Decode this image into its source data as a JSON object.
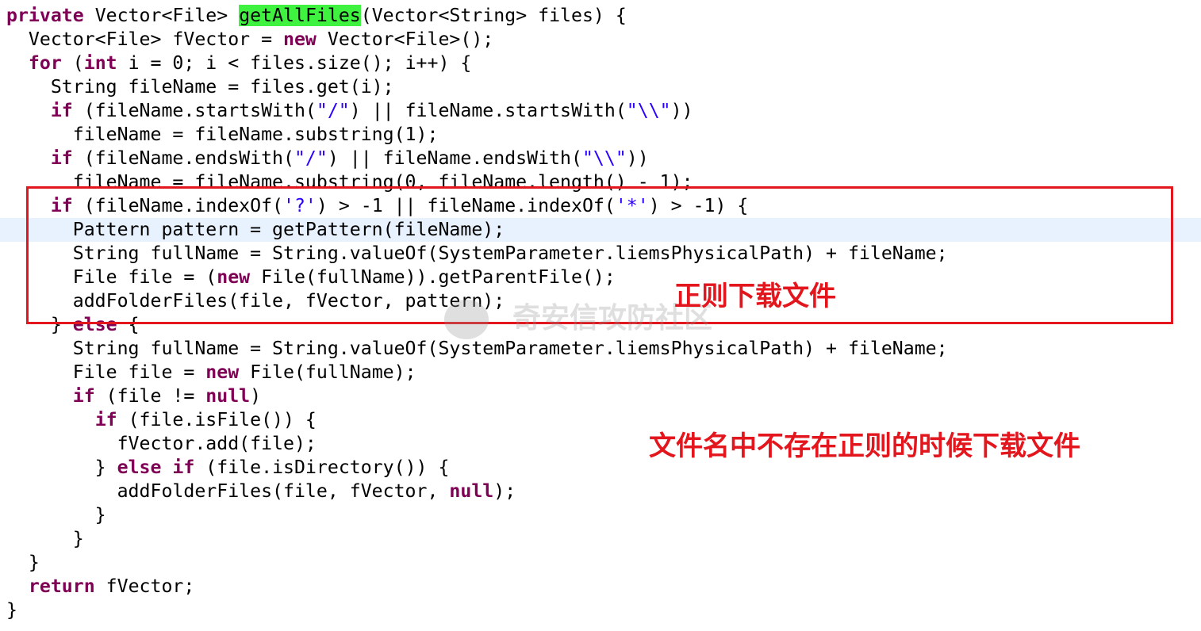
{
  "editor": {
    "highlight_color": "#3ff23f",
    "current_line_index": 9,
    "lines": [
      [
        [
          "k",
          "private"
        ],
        [
          "p",
          " Vector<File> "
        ],
        [
          "h",
          "getAllFiles"
        ],
        [
          "p",
          "(Vector<String> files) {"
        ]
      ],
      [
        [
          "p",
          "  Vector<File> fVector = "
        ],
        [
          "k",
          "new"
        ],
        [
          "p",
          " Vector<File>();"
        ]
      ],
      [
        [
          "p",
          "  "
        ],
        [
          "k",
          "for"
        ],
        [
          "p",
          " ("
        ],
        [
          "k",
          "int"
        ],
        [
          "p",
          " i = 0; i < files.size(); i++) {"
        ]
      ],
      [
        [
          "p",
          "    String fileName = files.get(i);"
        ]
      ],
      [
        [
          "p",
          "    "
        ],
        [
          "k",
          "if"
        ],
        [
          "p",
          " (fileName.startsWith("
        ],
        [
          "s",
          "\"/\""
        ],
        [
          "p",
          ") || fileName.startsWith("
        ],
        [
          "s",
          "\"\\\\\""
        ],
        [
          "p",
          "))"
        ]
      ],
      [
        [
          "p",
          "      fileName = fileName.substring(1);"
        ]
      ],
      [
        [
          "p",
          "    "
        ],
        [
          "k",
          "if"
        ],
        [
          "p",
          " (fileName.endsWith("
        ],
        [
          "s",
          "\"/\""
        ],
        [
          "p",
          ") || fileName.endsWith("
        ],
        [
          "s",
          "\"\\\\\""
        ],
        [
          "p",
          "))"
        ]
      ],
      [
        [
          "p",
          "      fileName = fileName.substring(0, fileName.length() - 1);"
        ]
      ],
      [
        [
          "p",
          "    "
        ],
        [
          "k",
          "if"
        ],
        [
          "p",
          " (fileName.indexOf("
        ],
        [
          "s",
          "'?'"
        ],
        [
          "p",
          ") > -1 || fileName.indexOf("
        ],
        [
          "s",
          "'*'"
        ],
        [
          "p",
          ") > -1) {"
        ]
      ],
      [
        [
          "p",
          "      Pattern pattern = getPattern(fileName);"
        ]
      ],
      [
        [
          "p",
          "      String fullName = String.valueOf(SystemParameter.liemsPhysicalPath) + fileName;"
        ]
      ],
      [
        [
          "p",
          "      File file = ("
        ],
        [
          "k",
          "new"
        ],
        [
          "p",
          " File(fullName)).getParentFile();"
        ]
      ],
      [
        [
          "p",
          "      addFolderFiles(file, fVector, pattern);"
        ]
      ],
      [
        [
          "p",
          "    } "
        ],
        [
          "k",
          "else"
        ],
        [
          "p",
          " {"
        ]
      ],
      [
        [
          "p",
          "      String fullName = String.valueOf(SystemParameter.liemsPhysicalPath) + fileName;"
        ]
      ],
      [
        [
          "p",
          "      File file = "
        ],
        [
          "k",
          "new"
        ],
        [
          "p",
          " File(fullName);"
        ]
      ],
      [
        [
          "p",
          "      "
        ],
        [
          "k",
          "if"
        ],
        [
          "p",
          " (file != "
        ],
        [
          "k",
          "null"
        ],
        [
          "p",
          ")"
        ]
      ],
      [
        [
          "p",
          "        "
        ],
        [
          "k",
          "if"
        ],
        [
          "p",
          " (file.isFile()) {"
        ]
      ],
      [
        [
          "p",
          "          fVector.add(file);"
        ]
      ],
      [
        [
          "p",
          "        } "
        ],
        [
          "k",
          "else if"
        ],
        [
          "p",
          " (file.isDirectory()) {"
        ]
      ],
      [
        [
          "p",
          "          addFolderFiles(file, fVector, "
        ],
        [
          "k",
          "null"
        ],
        [
          "p",
          ");"
        ]
      ],
      [
        [
          "p",
          "        }"
        ]
      ],
      [
        [
          "p",
          "      }"
        ]
      ],
      [
        [
          "p",
          "  }"
        ]
      ],
      [
        [
          "p",
          "  "
        ],
        [
          "k",
          "return"
        ],
        [
          "p",
          " fVector;"
        ]
      ],
      [
        [
          "p",
          "}"
        ]
      ]
    ]
  },
  "annotations": {
    "box_color": "#e3161d",
    "regex_note": "正则下载文件",
    "no_regex_note": "文件名中不存在正则的时候下载文件"
  },
  "watermark": "奇安信攻防社区"
}
